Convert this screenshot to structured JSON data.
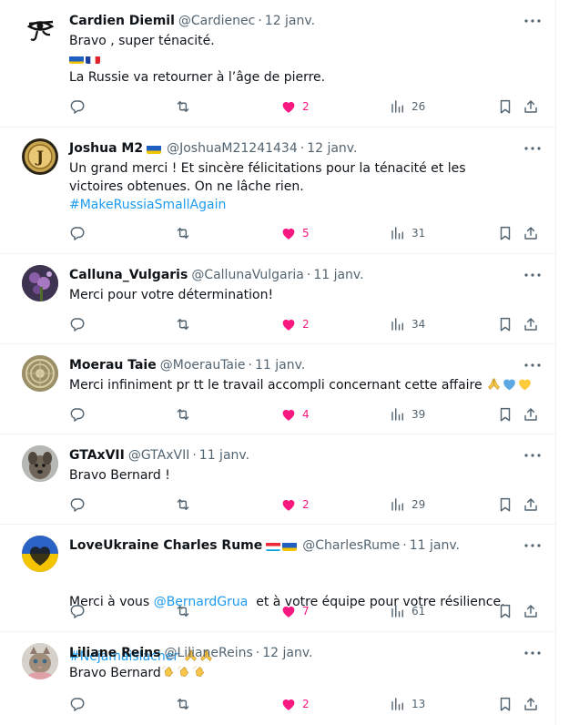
{
  "tweets": [
    {
      "name": "Cardien Diemil",
      "handle": "@Cardienec",
      "date": "12 janv.",
      "lines": [
        "Bravo , super ténacité.",
        "La Russie va retourner à l’âge de pierre."
      ],
      "likes": "2",
      "views": "26"
    },
    {
      "name": "Joshua M2",
      "handle": "@JoshuaM21241434",
      "date": "12 janv.",
      "text": "Un grand merci ! Et sincère félicitations pour la ténacité et les victoires obtenues. On ne lâche rien.",
      "hashtag": "#MakeRussiaSmallAgain",
      "likes": "5",
      "views": "31"
    },
    {
      "name": "Calluna_Vulgaris",
      "handle": "@CallunaVulgaria",
      "date": "11 janv.",
      "text": "Merci pour votre détermination!",
      "likes": "2",
      "views": "34"
    },
    {
      "name": "Moerau Taie",
      "handle": "@MoerauTaie",
      "date": "11 janv.",
      "text": "Merci infiniment pr tt le travail accompli concernant cette affaire",
      "likes": "4",
      "views": "39"
    },
    {
      "name": "GTAxVII",
      "handle": "@GTAxVII",
      "date": "11 janv.",
      "text": "Bravo Bernard !",
      "likes": "2",
      "views": "29"
    },
    {
      "name": "LoveUkraine Charles Rume",
      "handle": "@CharlesRume",
      "date": "11 janv.",
      "text_pre": "Merci à vous ",
      "mention": "@BernardGrua",
      "text_post": "  et à votre équipe pour votre résilience.",
      "hashtag": "#Nejamaislacher",
      "likes": "7",
      "views": "61"
    },
    {
      "name": "Liliane Reins",
      "handle": "@LilianeReins",
      "date": "12 janv.",
      "text": "Bravo Bernard",
      "likes": "2",
      "views": "13"
    }
  ],
  "dot": "·",
  "colors": {
    "like": "#f91880",
    "link": "#1d9bf0",
    "muted": "#536471"
  }
}
